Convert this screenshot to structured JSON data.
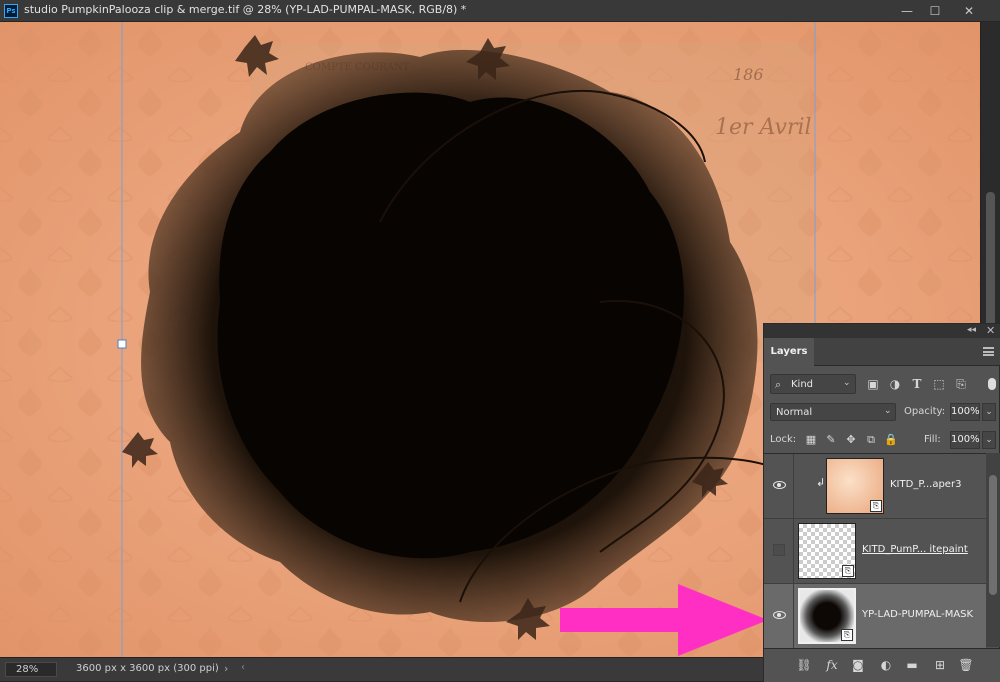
{
  "window": {
    "app_icon": "Ps",
    "title": "studio PumpkinPalooza clip & merge.tif @ 28% (YP-LAD-PUMPAL-MASK, RGB/8) *",
    "minimize": "—",
    "maximize": "☐",
    "close": "✕"
  },
  "status_bar": {
    "zoom": "28%",
    "doc_size": "3600 px x 3600 px (300 ppi)",
    "arrow": "›",
    "scroll_left": "‹"
  },
  "layers_panel": {
    "collapse_icon": "◂◂",
    "close_icon": "✕",
    "tab_label": "Layers",
    "filter": {
      "kind_label": "Kind",
      "search_icon": "⌕",
      "caret": "⌄",
      "icons": [
        "image-filter-icon",
        "adjustment-filter-icon",
        "type-filter-icon",
        "shape-filter-icon",
        "smart-object-filter-icon"
      ]
    },
    "blend_mode": "Normal",
    "blend_caret": "⌄",
    "opacity_label": "Opacity:",
    "opacity_value": "100%",
    "lock_label": "Lock:",
    "fill_label": "Fill:",
    "fill_value": "100%",
    "layers": [
      {
        "name": "KITD_P...aper3",
        "visible": true,
        "clipped": true,
        "selected": false,
        "thumb": "paper"
      },
      {
        "name": "KITD_PumP... itepaint",
        "visible": false,
        "clipped": false,
        "selected": false,
        "thumb": "transparent"
      },
      {
        "name": "YP-LAD-PUMPAL-MASK",
        "visible": true,
        "clipped": false,
        "selected": true,
        "thumb": "mask"
      }
    ],
    "footer_icons": [
      "link-icon",
      "fx-icon",
      "mask-icon",
      "adjustment-icon",
      "group-folder-icon",
      "new-layer-icon",
      "trash-icon"
    ]
  },
  "colors": {
    "canvas_paper": "#e9a37c",
    "mask_dark": "#140c06",
    "arrow_pink": "#ff2fc4",
    "panel_bg": "#535353",
    "selected_row": "#6a6a6a"
  }
}
